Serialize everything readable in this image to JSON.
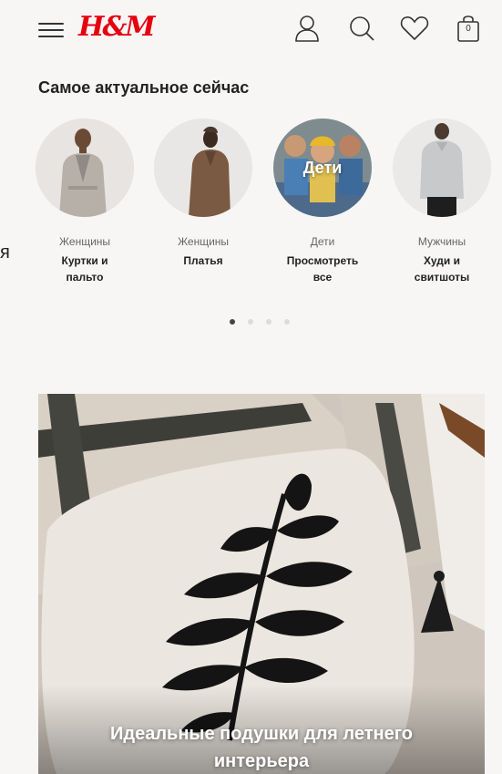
{
  "header": {
    "logo": "H&M",
    "cart_count": "0",
    "icons": [
      "menu-icon",
      "account-icon",
      "search-icon",
      "favorites-icon",
      "bag-icon"
    ],
    "brand_color": "#e50010"
  },
  "section": {
    "title": "Самое актуальное сейчас",
    "edge_fragment": "я"
  },
  "categories": [
    {
      "dept": "Женщины",
      "line1": "Куртки и",
      "line2": "пальто"
    },
    {
      "dept": "Женщины",
      "line1": "Платья",
      "line2": ""
    },
    {
      "dept": "Дети",
      "line1": "Просмотреть",
      "line2": "все",
      "overlay": "Дети"
    },
    {
      "dept": "Мужчины",
      "line1": "Худи и",
      "line2": "свитшоты"
    }
  ],
  "pagination": {
    "total": 4,
    "active": 1
  },
  "banner": {
    "line1": "Идеальные подушки для летнего",
    "line2": "интерьера"
  }
}
